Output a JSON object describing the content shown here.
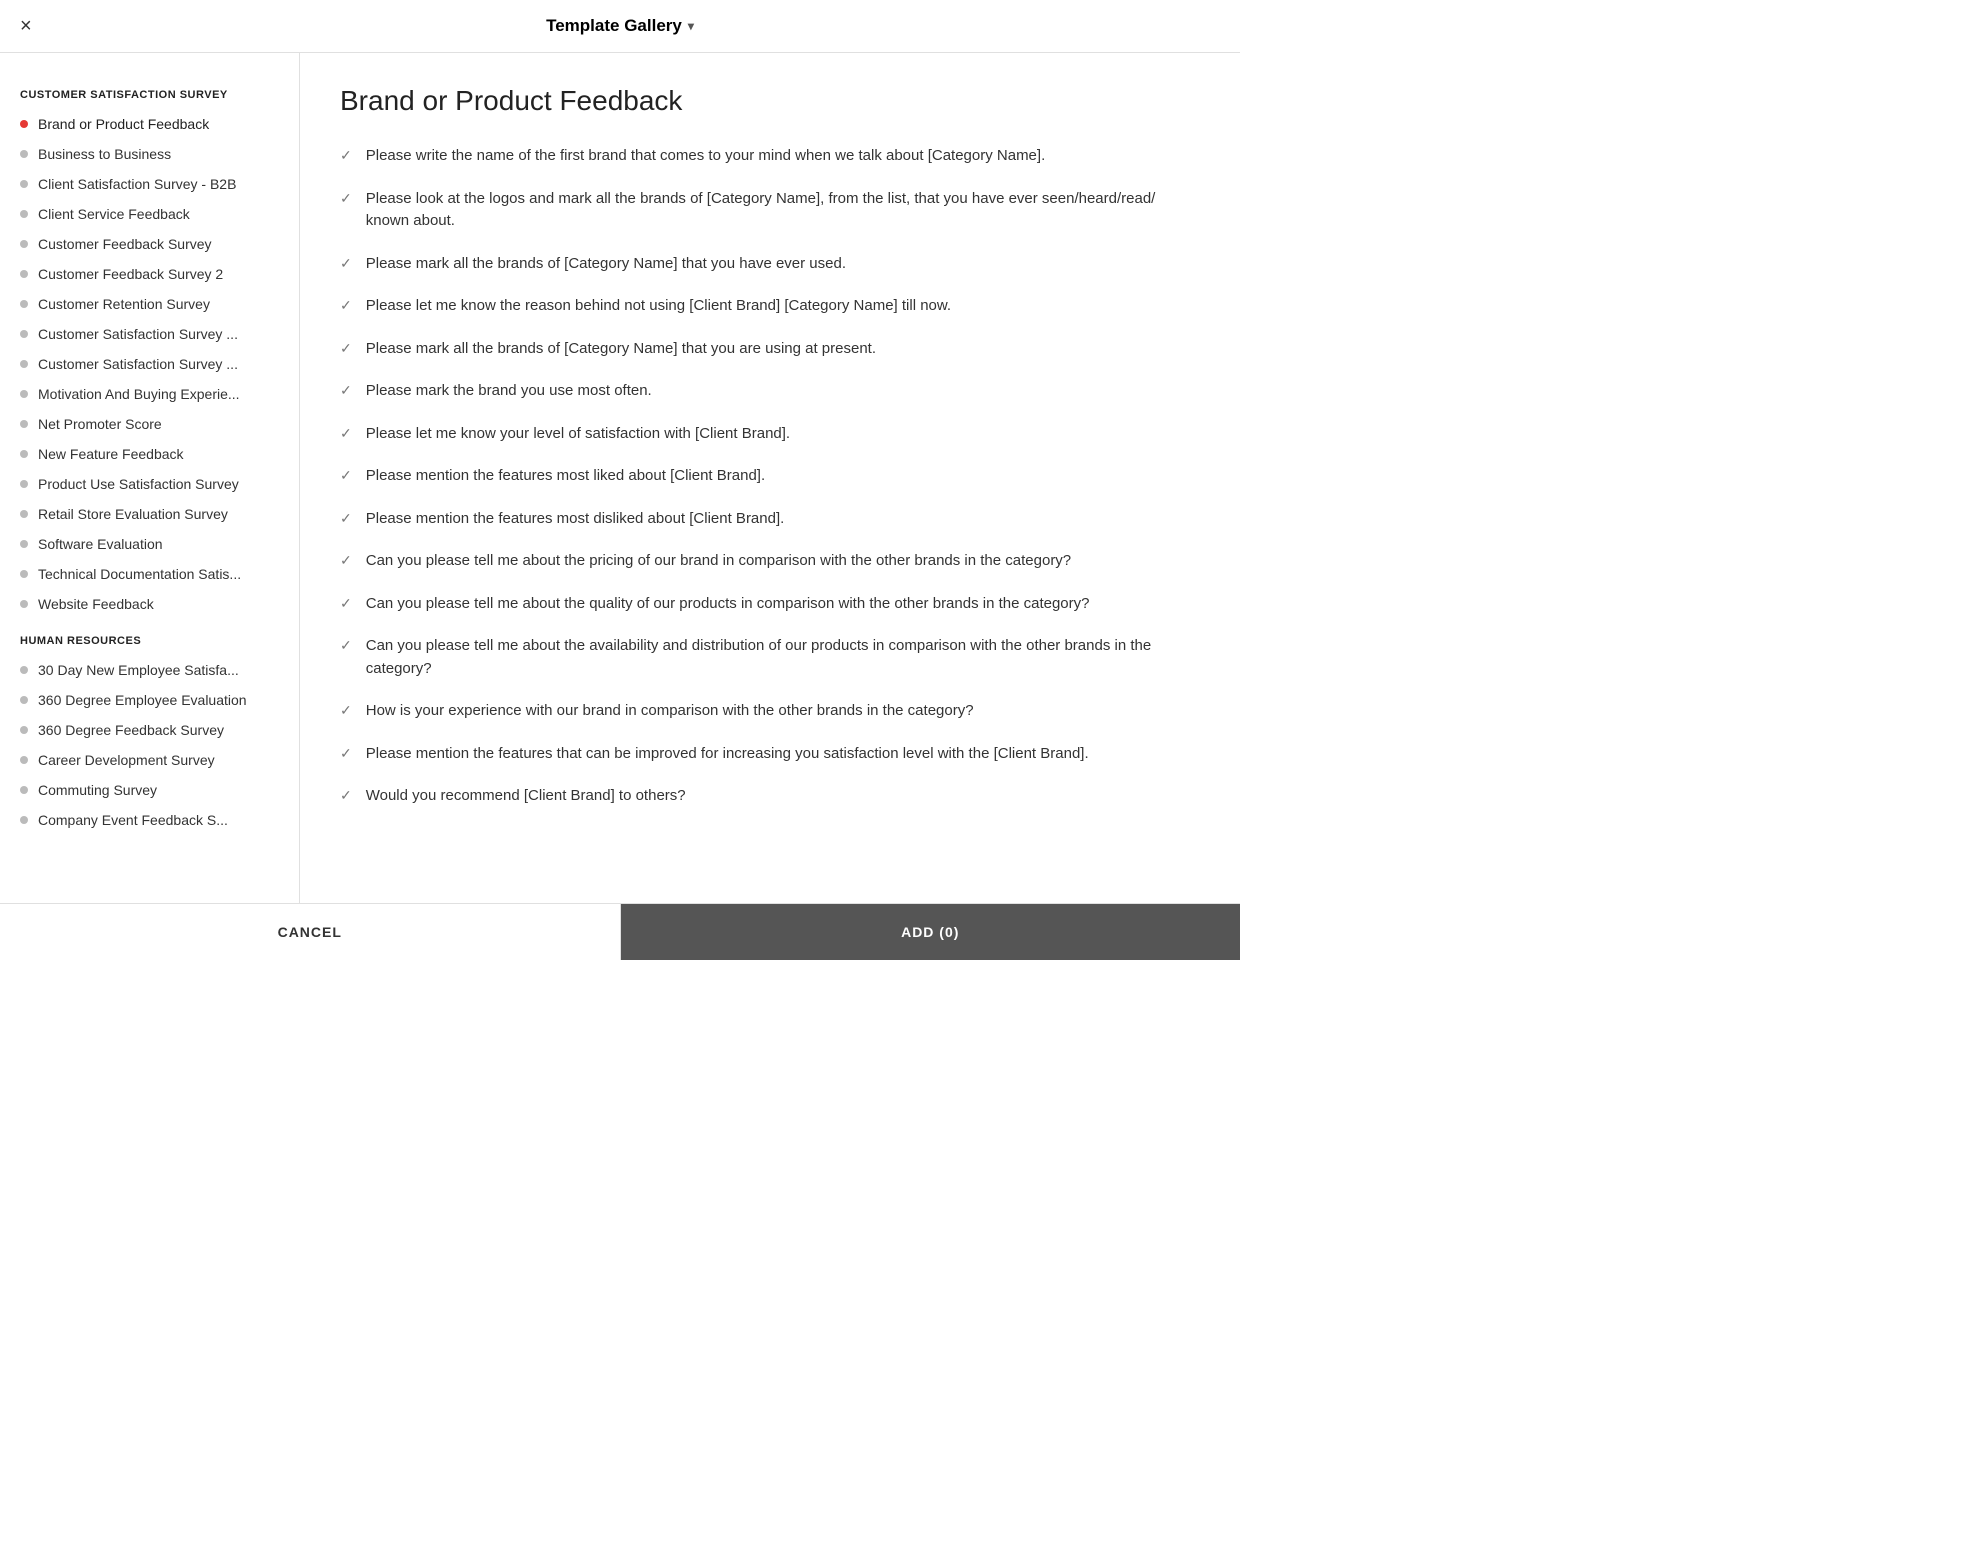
{
  "header": {
    "title": "Template Gallery",
    "chevron": "▾",
    "close_label": "×"
  },
  "sidebar": {
    "sections": [
      {
        "title": "CUSTOMER SATISFACTION SURVEY",
        "items": [
          {
            "label": "Brand or Product Feedback",
            "active": true
          },
          {
            "label": "Business to Business",
            "active": false
          },
          {
            "label": "Client Satisfaction Survey - B2B",
            "active": false
          },
          {
            "label": "Client Service Feedback",
            "active": false
          },
          {
            "label": "Customer Feedback Survey",
            "active": false
          },
          {
            "label": "Customer Feedback Survey 2",
            "active": false
          },
          {
            "label": "Customer Retention Survey",
            "active": false
          },
          {
            "label": "Customer Satisfaction Survey ...",
            "active": false
          },
          {
            "label": "Customer Satisfaction Survey ...",
            "active": false
          },
          {
            "label": "Motivation And Buying Experie...",
            "active": false
          },
          {
            "label": "Net Promoter Score",
            "active": false
          },
          {
            "label": "New Feature Feedback",
            "active": false
          },
          {
            "label": "Product Use Satisfaction Survey",
            "active": false
          },
          {
            "label": "Retail Store Evaluation Survey",
            "active": false
          },
          {
            "label": "Software Evaluation",
            "active": false
          },
          {
            "label": "Technical Documentation Satis...",
            "active": false
          },
          {
            "label": "Website Feedback",
            "active": false
          }
        ]
      },
      {
        "title": "HUMAN RESOURCES",
        "items": [
          {
            "label": "30 Day New Employee Satisfa...",
            "active": false
          },
          {
            "label": "360 Degree Employee Evaluation",
            "active": false
          },
          {
            "label": "360 Degree Feedback Survey",
            "active": false
          },
          {
            "label": "Career Development Survey",
            "active": false
          },
          {
            "label": "Commuting Survey",
            "active": false
          },
          {
            "label": "Company Event Feedback S...",
            "active": false
          }
        ]
      }
    ]
  },
  "content": {
    "title": "Brand or Product Feedback",
    "questions": [
      "Please write the name of the first brand that comes to your mind when we talk about [Category Name].",
      "Please look at the logos and mark all the brands of [Category Name], from the list, that you have ever seen/heard/read/ known about.",
      "Please mark all the brands of [Category Name] that you have ever used.",
      "Please let me know the reason behind not using [Client Brand] [Category Name] till now.",
      "Please mark all the brands of [Category Name] that you are using at present.",
      "Please mark the brand you use most often.",
      "Please let me know your level of satisfaction with [Client Brand].",
      "Please mention the features most liked about [Client Brand].",
      "Please mention the features most disliked about [Client Brand].",
      "Can you please tell me about the pricing of our brand in comparison with the other brands in the category?",
      "Can you please tell me about the quality of our products in comparison with the other brands in the category?",
      "Can you please tell me about the availability and distribution of our products in comparison with the other brands in the category?",
      "How is your experience with our brand in comparison with the other brands in the category?",
      "Please mention the features that can be improved for increasing you satisfaction level with the [Client Brand].",
      "Would you recommend [Client Brand] to others?"
    ]
  },
  "footer": {
    "cancel_label": "CANCEL",
    "add_label": "ADD (0)"
  }
}
